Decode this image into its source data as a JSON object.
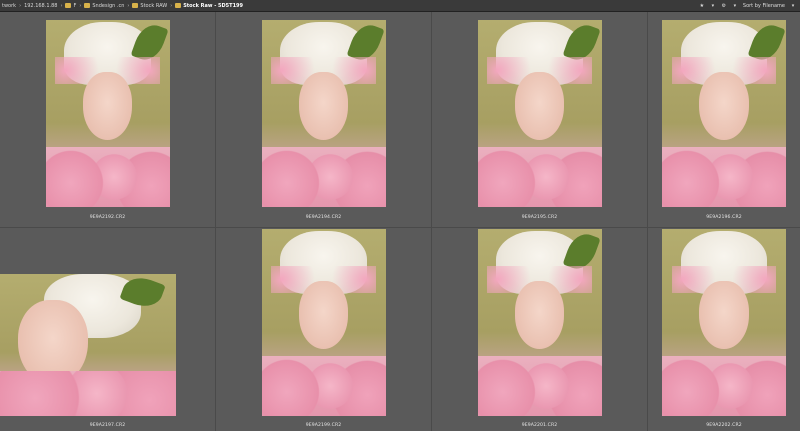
{
  "breadcrumb": {
    "items": [
      {
        "label": "twork",
        "folder": false
      },
      {
        "label": "192.168.1.88",
        "folder": false
      },
      {
        "label": "F",
        "folder": true
      },
      {
        "label": "Sndesign .cn",
        "folder": true
      },
      {
        "label": "Stock RAW",
        "folder": true
      },
      {
        "label": "Stock Raw - 5D5T199",
        "folder": true
      }
    ]
  },
  "toolbar": {
    "star_glyph": "★",
    "sort_label": "Sort by Filename"
  },
  "thumbnails": [
    {
      "filename": "9E9A2192.CR2",
      "orientation": "portrait"
    },
    {
      "filename": "9E9A2194.CR2",
      "orientation": "portrait"
    },
    {
      "filename": "9E9A2195.CR2",
      "orientation": "portrait"
    },
    {
      "filename": "9E9A2196.CR2",
      "orientation": "portrait"
    },
    {
      "filename": "9E9A2197.CR2",
      "orientation": "landscape"
    },
    {
      "filename": "9E9A2199.CR2",
      "orientation": "portrait"
    },
    {
      "filename": "9E9A2201.CR2",
      "orientation": "portrait"
    },
    {
      "filename": "9E9A2202.CR2",
      "orientation": "portrait"
    }
  ]
}
